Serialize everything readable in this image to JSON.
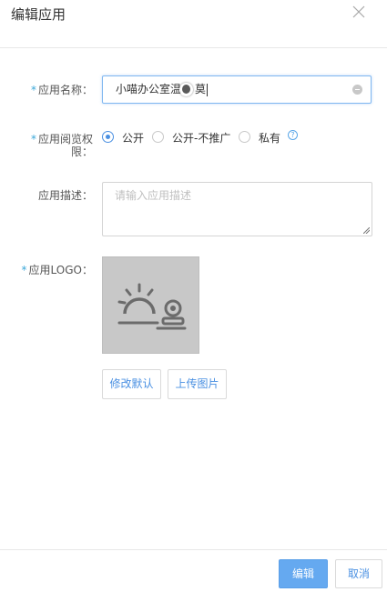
{
  "dialog": {
    "title": "编辑应用"
  },
  "form": {
    "name": {
      "label": "应用名称：",
      "value": "小喵办公室温",
      "value_tail": "莫"
    },
    "permission": {
      "label_line1": "应用阅览权",
      "label_line2": "限：",
      "options": [
        {
          "label": "公开",
          "checked": true
        },
        {
          "label": "公开-不推广",
          "checked": false
        },
        {
          "label": "私有",
          "checked": false
        }
      ],
      "help_glyph": "?"
    },
    "description": {
      "label": "应用描述：",
      "placeholder": "请输入应用描述"
    },
    "logo": {
      "label": "应用LOGO：",
      "reset_button": "修改默认",
      "upload_button": "上传图片"
    }
  },
  "footer": {
    "edit_button": "编辑",
    "cancel_button": "取消"
  },
  "colors": {
    "accent": "#4a90e2",
    "required_mark": "#3aa7d8",
    "primary_button": "#65a9f0",
    "logo_bg": "#c8c8c8"
  },
  "icons": {
    "close": "close-icon",
    "clear": "clear-input-icon",
    "help": "help-icon",
    "logo_placeholder": "sunset-webcam-icon"
  }
}
